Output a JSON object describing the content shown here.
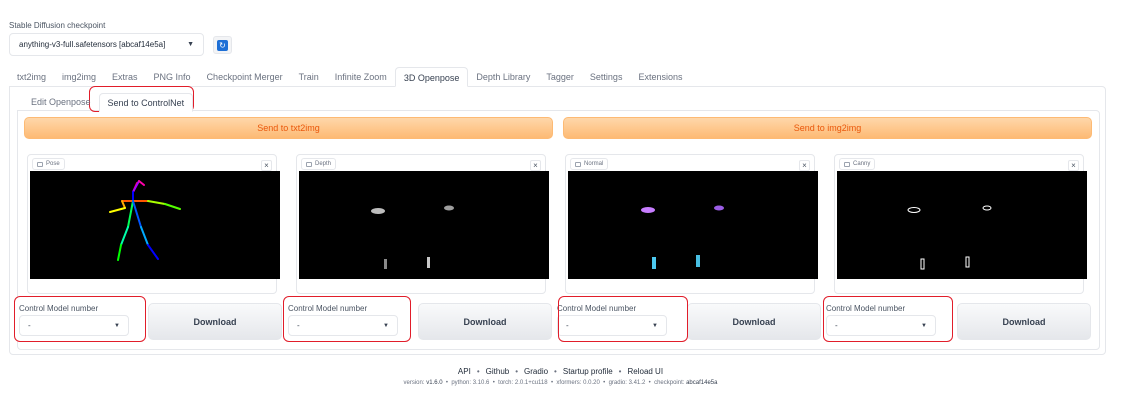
{
  "checkpoint": {
    "label": "Stable Diffusion checkpoint",
    "value": "anything-v3-full.safetensors [abcaf14e5a]"
  },
  "tabs": [
    {
      "label": "txt2img"
    },
    {
      "label": "img2img"
    },
    {
      "label": "Extras"
    },
    {
      "label": "PNG Info"
    },
    {
      "label": "Checkpoint Merger"
    },
    {
      "label": "Train"
    },
    {
      "label": "Infinite Zoom"
    },
    {
      "label": "3D Openpose",
      "selected": true
    },
    {
      "label": "Depth Library"
    },
    {
      "label": "Tagger"
    },
    {
      "label": "Settings"
    },
    {
      "label": "Extensions"
    }
  ],
  "subtabs": [
    {
      "label": "Edit Openpose"
    },
    {
      "label": "Send to ControlNet",
      "selected": true
    }
  ],
  "send_buttons": {
    "txt2img": "Send to txt2img",
    "img2img": "Send to img2img"
  },
  "images": [
    {
      "label": "Pose"
    },
    {
      "label": "Depth"
    },
    {
      "label": "Normal"
    },
    {
      "label": "Canny"
    }
  ],
  "controls": [
    {
      "model_label": "Control Model number",
      "model_value": "-",
      "download_label": "Download"
    },
    {
      "model_label": "Control Model number",
      "model_value": "-",
      "download_label": "Download"
    },
    {
      "model_label": "Control Model number",
      "model_value": "-",
      "download_label": "Download"
    },
    {
      "model_label": "Control Model number",
      "model_value": "-",
      "download_label": "Download"
    }
  ],
  "footer": {
    "links": [
      "API",
      "Github",
      "Gradio",
      "Startup profile",
      "Reload UI"
    ],
    "version": {
      "version_label": "version:",
      "version": "v1.6.0",
      "python_label": "python:",
      "python": "3.10.6",
      "torch_label": "torch:",
      "torch": "2.0.1+cu118",
      "xformers_label": "xformers:",
      "xformers": "0.0.20",
      "gradio_label": "gradio:",
      "gradio": "3.41.2",
      "checkpoint_label": "checkpoint:",
      "checkpoint": "abcaf14e5a"
    }
  },
  "colors": {
    "highlight": "#e11d2a",
    "send_button_text": "#ea580c",
    "refresh_icon": "#1d6fd6"
  }
}
